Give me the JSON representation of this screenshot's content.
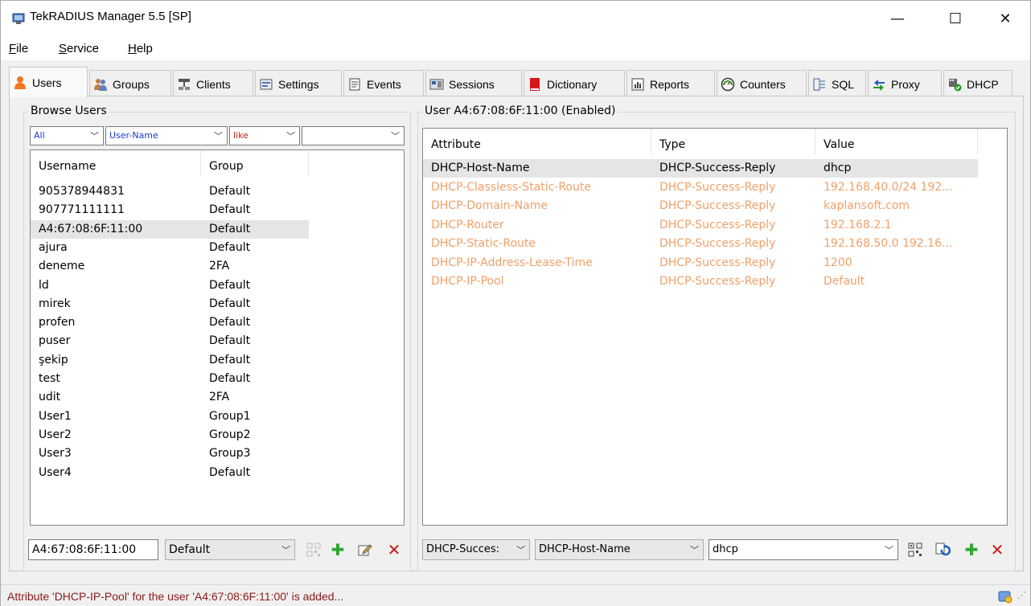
{
  "window": {
    "title": "TekRADIUS Manager 5.5 [SP]",
    "minimize": "—",
    "maximize": "☐",
    "close": "✕"
  },
  "menu": [
    {
      "underline": "F",
      "rest": "ile"
    },
    {
      "underline": "S",
      "rest": "ervice"
    },
    {
      "underline": "H",
      "rest": "elp"
    }
  ],
  "tabs": [
    {
      "label": "Users",
      "icon": "user-icon"
    },
    {
      "label": "Groups",
      "icon": "groups-icon"
    },
    {
      "label": "Clients",
      "icon": "clients-icon"
    },
    {
      "label": "Settings",
      "icon": "settings-icon"
    },
    {
      "label": "Events",
      "icon": "events-icon"
    },
    {
      "label": "Sessions",
      "icon": "sessions-icon"
    },
    {
      "label": "Dictionary",
      "icon": "dictionary-icon"
    },
    {
      "label": "Reports",
      "icon": "reports-icon"
    },
    {
      "label": "Counters",
      "icon": "counters-icon"
    },
    {
      "label": "SQL",
      "icon": "sql-icon"
    },
    {
      "label": "Proxy",
      "icon": "proxy-icon"
    },
    {
      "label": "DHCP",
      "icon": "dhcp-icon"
    }
  ],
  "browse": {
    "title": "Browse Users",
    "filter_scope": "All",
    "filter_field": "User-Name",
    "filter_op": "like",
    "filter_value": "",
    "columns": [
      "Username",
      "Group"
    ],
    "rows": [
      [
        "905378944831",
        "Default"
      ],
      [
        "907771111111",
        "Default"
      ],
      [
        "A4:67:08:6F:11:00",
        "Default"
      ],
      [
        "ajura",
        "Default"
      ],
      [
        "deneme",
        "2FA"
      ],
      [
        "ld",
        "Default"
      ],
      [
        "mirek",
        "Default"
      ],
      [
        "profen",
        "Default"
      ],
      [
        "puser",
        "Default"
      ],
      [
        "şekip",
        "Default"
      ],
      [
        "test",
        "Default"
      ],
      [
        "udit",
        "2FA"
      ],
      [
        "User1",
        "Group1"
      ],
      [
        "User2",
        "Group2"
      ],
      [
        "User3",
        "Group3"
      ],
      [
        "User4",
        "Default"
      ]
    ],
    "selected_row": 2,
    "username_input": "A4:67:08:6F:11:00",
    "group_select": "Default"
  },
  "user": {
    "title": "User A4:67:08:6F:11:00 (Enabled)",
    "columns": [
      "Attribute",
      "Type",
      "Value"
    ],
    "rows": [
      [
        "DHCP-Host-Name",
        "DHCP-Success-Reply",
        "dhcp"
      ],
      [
        "DHCP-Classless-Static-Route",
        "DHCP-Success-Reply",
        "192.168.40.0/24 192..."
      ],
      [
        "DHCP-Domain-Name",
        "DHCP-Success-Reply",
        "kaplansoft.com"
      ],
      [
        "DHCP-Router",
        "DHCP-Success-Reply",
        "192.168.2.1"
      ],
      [
        "DHCP-Static-Route",
        "DHCP-Success-Reply",
        "192.168.50.0 192.16..."
      ],
      [
        "DHCP-IP-Address-Lease-Time",
        "DHCP-Success-Reply",
        "1200"
      ],
      [
        "DHCP-IP-Pool",
        "DHCP-Success-Reply",
        "Default"
      ]
    ],
    "type_select": "DHCP-Succes:",
    "attr_select": "DHCP-Host-Name",
    "value_input": "dhcp"
  },
  "status": {
    "text": "Attribute 'DHCP-IP-Pool' for the user 'A4:67:08:6F:11:00' is added..."
  },
  "colors": {
    "accent_orange": "#f0a068",
    "status_red": "#8b1a1a",
    "add_green": "#2fa82f",
    "delete_red": "#d01818"
  }
}
